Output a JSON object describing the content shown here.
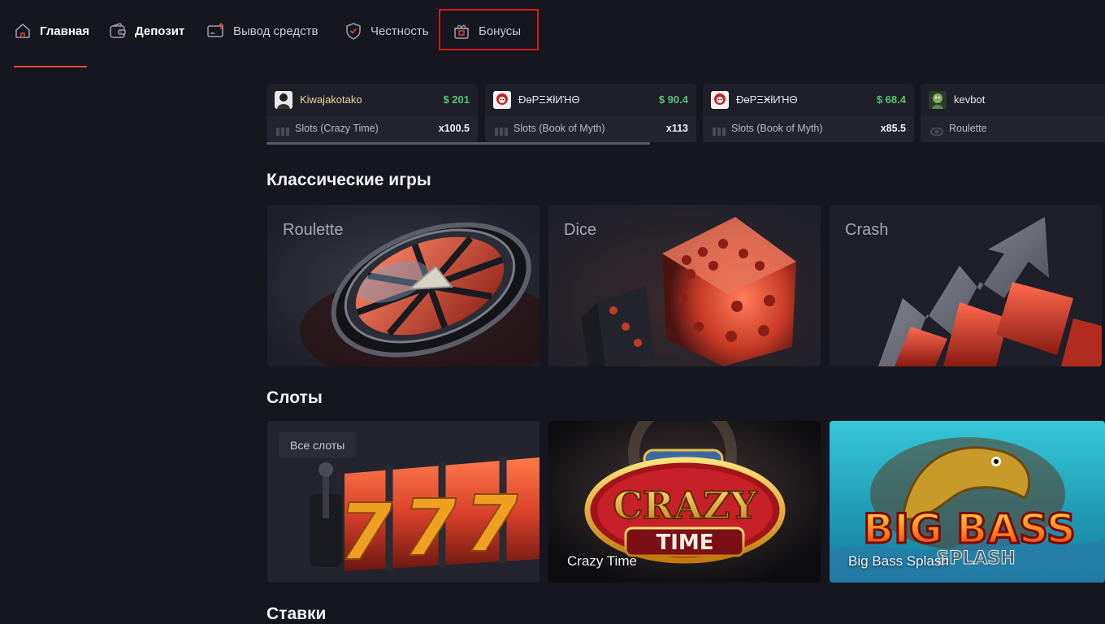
{
  "nav": {
    "items": [
      {
        "label": "Главная",
        "icon": "home-icon"
      },
      {
        "label": "Депозит",
        "icon": "wallet-icon"
      },
      {
        "label": "Вывод средств",
        "icon": "withdraw-card-icon"
      },
      {
        "label": "Честность",
        "icon": "shield-check-icon"
      },
      {
        "label": "Бонусы",
        "icon": "gift-icon"
      }
    ],
    "accent_color": "#e0463a",
    "highlight_color": "#d7141a"
  },
  "ticker": {
    "cards": [
      {
        "user": "Kiwajakotako",
        "amount": "$ 201",
        "game": "Slots (Crazy Time)",
        "multiplier": "x100.5"
      },
      {
        "user": "ĐɵРΞӾłИΉΘ",
        "amount": "$ 90.4",
        "game": "Slots (Book of Myth)",
        "multiplier": "x113"
      },
      {
        "user": "ĐɵРΞӾłИΉΘ",
        "amount": "$ 68.4",
        "game": "Slots (Book of Myth)",
        "multiplier": "x85.5"
      },
      {
        "user": "kevbot",
        "amount": "$",
        "game": "Roulette",
        "multiplier": ""
      }
    ],
    "amount_color": "#56c46e"
  },
  "sections": {
    "classic": {
      "title": "Классические игры",
      "tiles": [
        {
          "label": "Roulette"
        },
        {
          "label": "Dice"
        },
        {
          "label": "Crash"
        }
      ]
    },
    "slots": {
      "title": "Слоты",
      "all_slots_label": "Все слоты",
      "tiles": [
        {
          "caption": "Crazy Time",
          "logo_text_1": "CRAZY",
          "logo_text_2": "TIME"
        },
        {
          "caption": "Big Bass Splash",
          "logo_text_1": "BIG BASS",
          "logo_text_2": "SPLASH"
        }
      ]
    },
    "bets": {
      "title": "Ставки"
    }
  }
}
